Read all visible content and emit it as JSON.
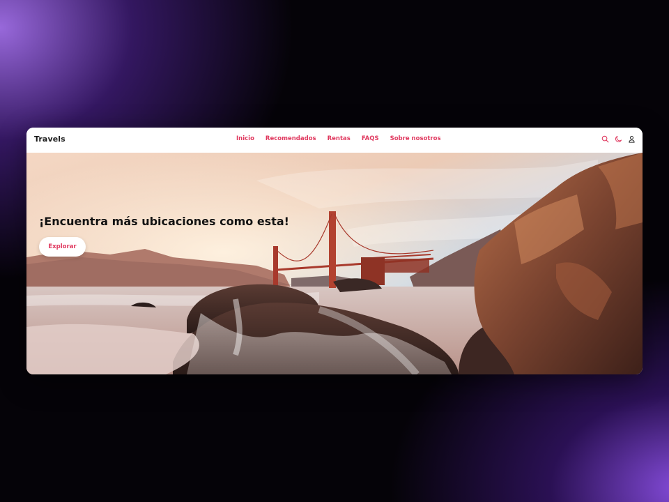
{
  "header": {
    "brand": "Travels",
    "nav": [
      "Inicio",
      "Recomendados",
      "Rentas",
      "FAQS",
      "Sobre nosotros"
    ],
    "icons": [
      "search-icon",
      "moon-icon",
      "user-icon"
    ],
    "accent_color": "#e0395f"
  },
  "hero": {
    "title": "¡Encuentra más ubicaciones como esta!",
    "button_label": "Explorar"
  }
}
